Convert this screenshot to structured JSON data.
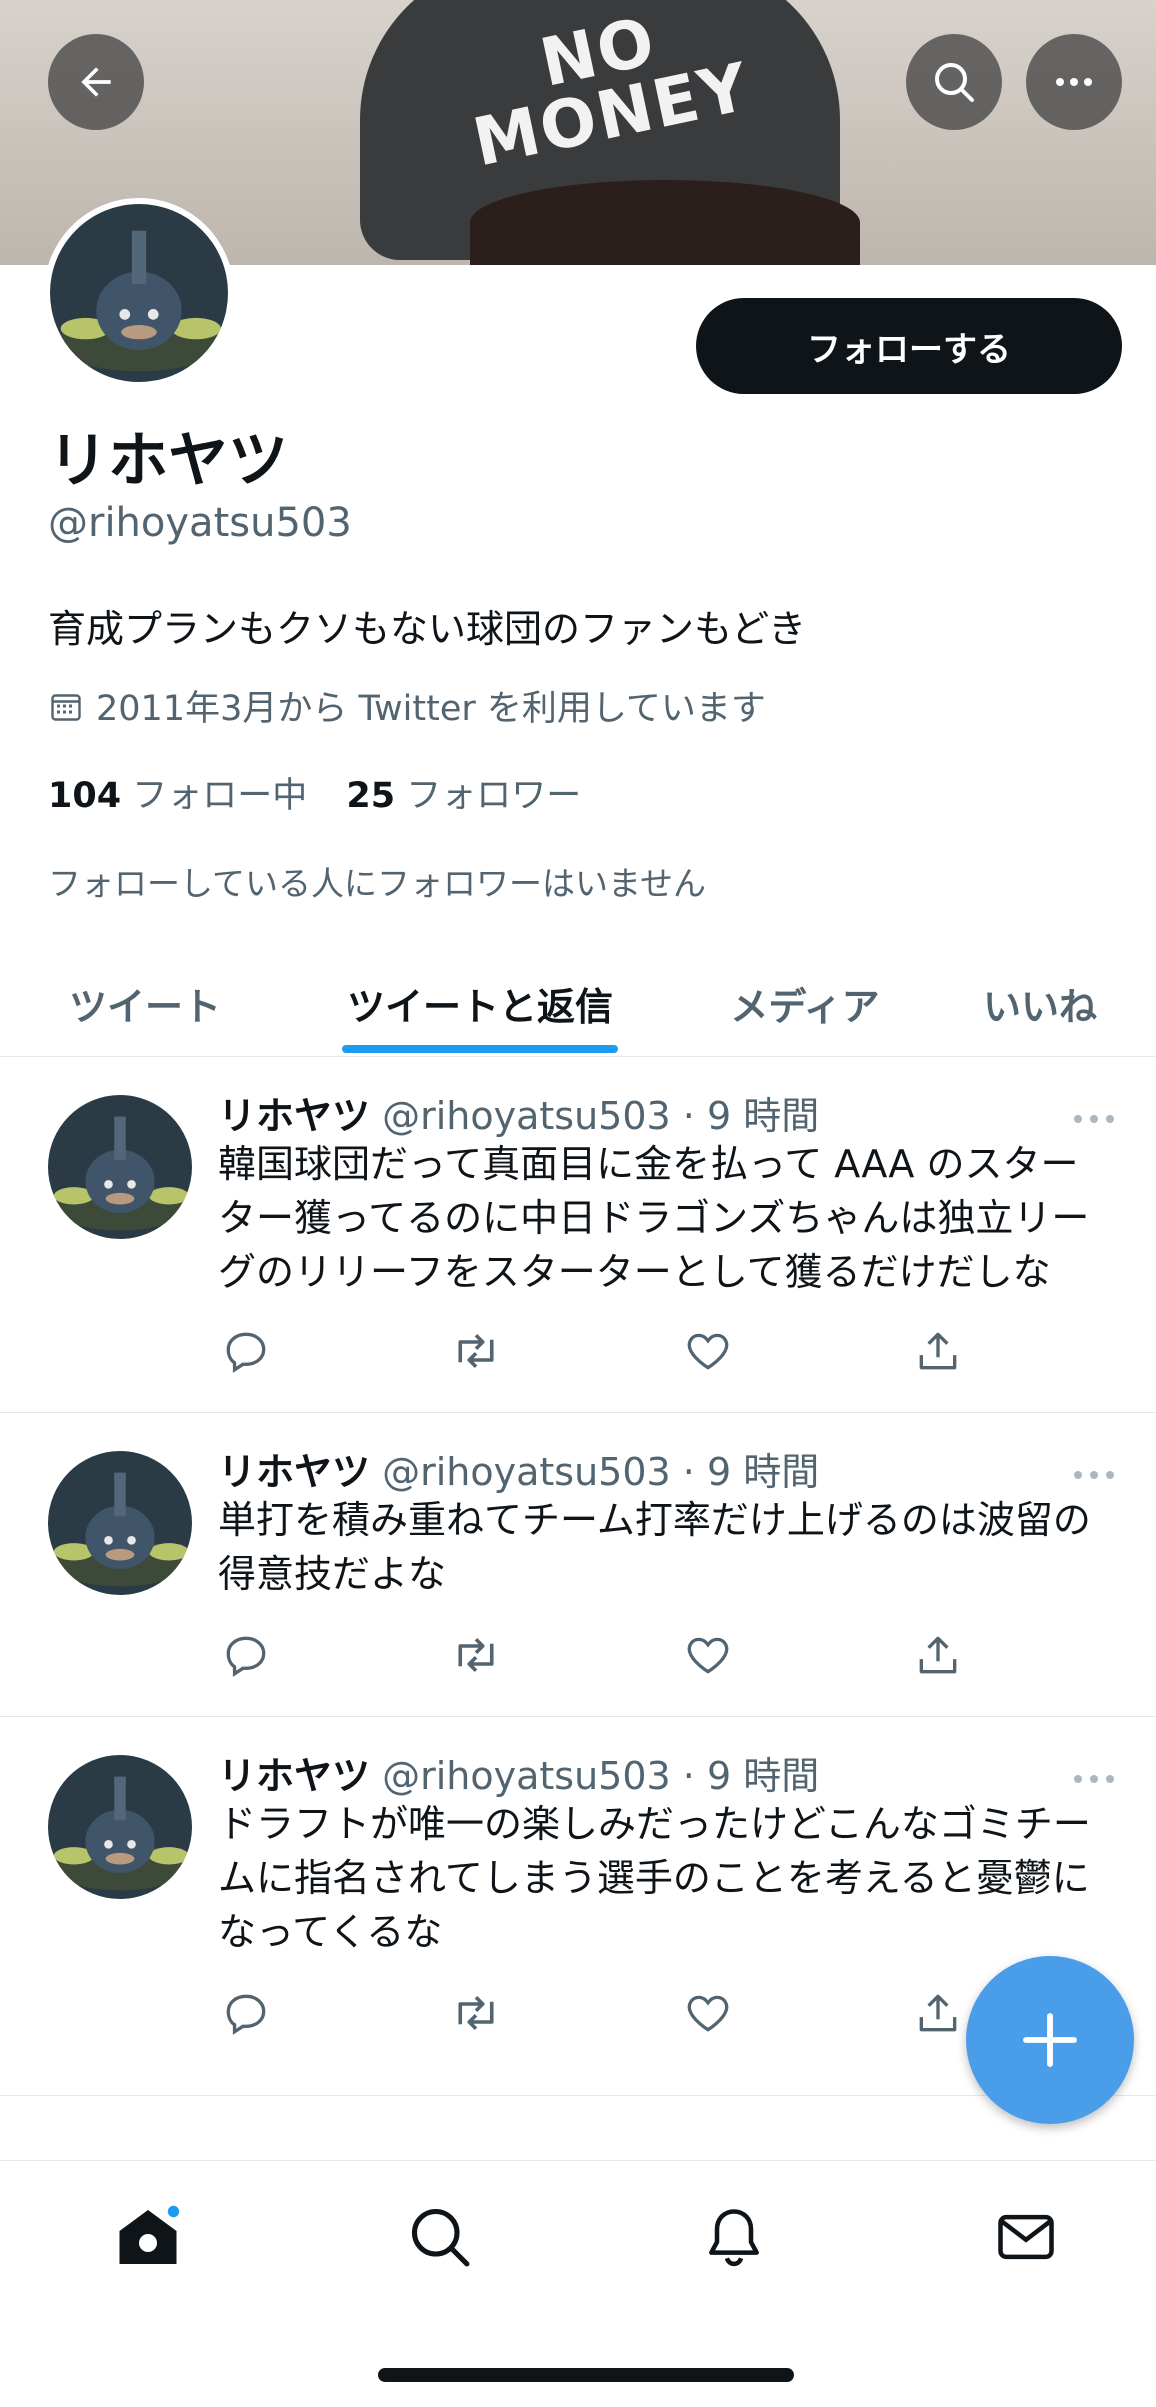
{
  "banner": {
    "cap_text_line1": "NO",
    "cap_text_line2": "MONEY"
  },
  "profile": {
    "follow_button": "フォローする",
    "name": "リホヤツ",
    "handle": "@rihoyatsu503",
    "bio": "育成プランもクソもない球団のファンもどき",
    "joined": "2011年3月から Twitter を利用しています",
    "following_count": "104",
    "following_label": "フォロー中",
    "followers_count": "25",
    "followers_label": "フォロワー",
    "no_mutual_followers": "フォローしている人にフォロワーはいません"
  },
  "tabs": [
    {
      "label": "ツイート",
      "active": false
    },
    {
      "label": "ツイートと返信",
      "active": true
    },
    {
      "label": "メディア",
      "active": false
    },
    {
      "label": "いいね",
      "active": false
    }
  ],
  "tweets": [
    {
      "name": "リホヤツ",
      "meta": "@rihoyatsu503 · 9 時間",
      "lines": [
        "韓国球団だって真面目に金を払って AAA のスター",
        "ター獲ってるのに中日ドラゴンズちゃんは独立リー",
        "グのリリーフをスターターとして獲るだけだしな"
      ]
    },
    {
      "name": "リホヤツ",
      "meta": "@rihoyatsu503 · 9 時間",
      "lines": [
        "単打を積み重ねてチーム打率だけ上げるのは波留の",
        "得意技だよな"
      ]
    },
    {
      "name": "リホヤツ",
      "meta": "@rihoyatsu503 · 9 時間",
      "lines": [
        "ドラフトが唯一の楽しみだったけどこんなゴミチー",
        "ムに指名されてしまう選手のことを考えると憂鬱に",
        "なってくるな"
      ]
    }
  ],
  "icons": {
    "back": "arrow-left-icon",
    "search": "search-icon",
    "more": "more-icon",
    "reply": "reply-icon",
    "retweet": "retweet-icon",
    "like": "heart-icon",
    "share": "share-icon",
    "compose": "plus-icon",
    "nav": [
      "home-icon",
      "search-icon",
      "bell-icon",
      "mail-icon"
    ]
  },
  "colors": {
    "accent": "#1d9bf0",
    "fab": "#4a9de8",
    "text": "#0f1419",
    "secondary": "#536471"
  }
}
